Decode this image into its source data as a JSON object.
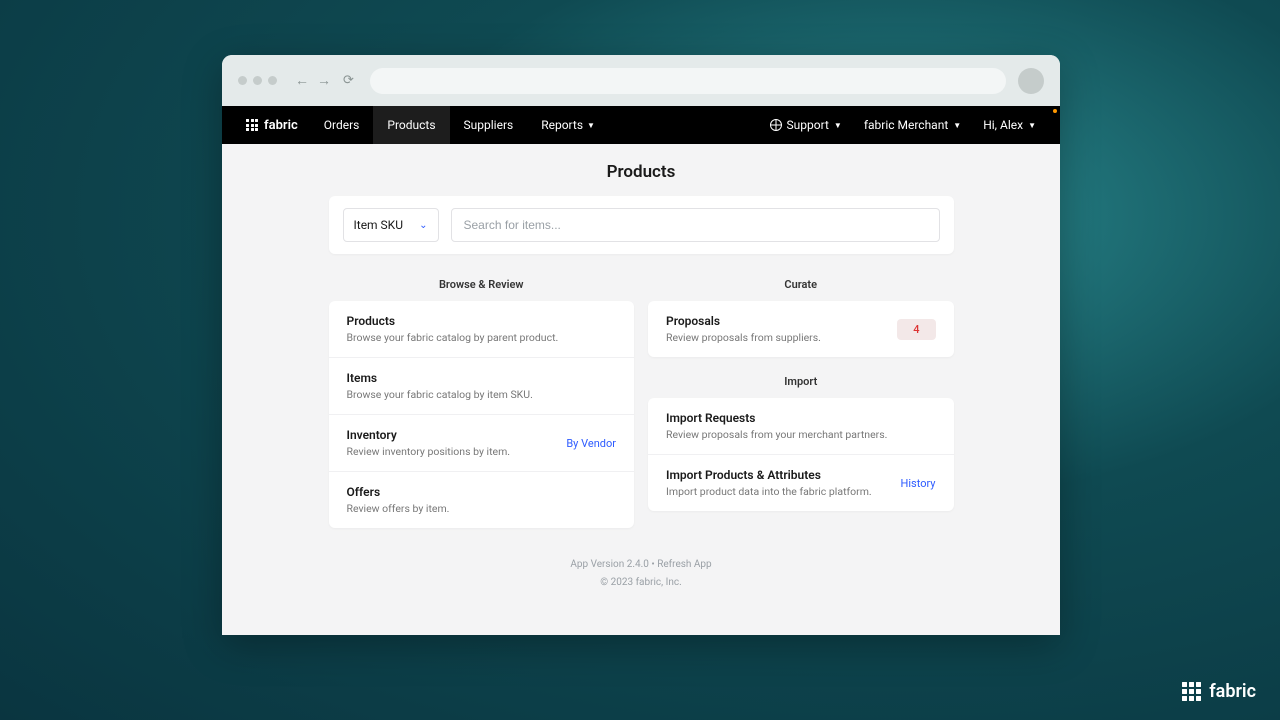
{
  "brand": "fabric",
  "nav": {
    "items": [
      "Orders",
      "Products",
      "Suppliers",
      "Reports"
    ],
    "active": "Products",
    "support": "Support",
    "merchant": "fabric Merchant",
    "user_greeting": "Hi, Alex"
  },
  "page": {
    "title": "Products"
  },
  "search": {
    "select_label": "Item SKU",
    "placeholder": "Search for items..."
  },
  "sections": {
    "browse": {
      "title": "Browse & Review",
      "items": [
        {
          "title": "Products",
          "desc": "Browse your fabric catalog by parent product."
        },
        {
          "title": "Items",
          "desc": "Browse your fabric catalog by item SKU."
        },
        {
          "title": "Inventory",
          "desc": "Review inventory positions by item.",
          "action": "By Vendor"
        },
        {
          "title": "Offers",
          "desc": "Review offers by item."
        }
      ]
    },
    "curate": {
      "title": "Curate",
      "items": [
        {
          "title": "Proposals",
          "desc": "Review proposals from suppliers.",
          "badge": "4"
        }
      ]
    },
    "import": {
      "title": "Import",
      "items": [
        {
          "title": "Import Requests",
          "desc": "Review proposals from your merchant partners."
        },
        {
          "title": "Import Products & Attributes",
          "desc": "Import product data into the fabric platform.",
          "action": "History"
        }
      ]
    }
  },
  "footer": {
    "version": "App Version 2.4.0",
    "refresh": "Refresh App",
    "copyright": "© 2023 fabric, Inc."
  }
}
